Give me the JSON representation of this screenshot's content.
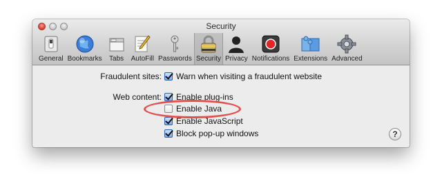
{
  "window": {
    "title": "Security"
  },
  "toolbar": {
    "items": [
      {
        "label": "General",
        "icon": "switch-icon"
      },
      {
        "label": "Bookmarks",
        "icon": "globe-icon"
      },
      {
        "label": "Tabs",
        "icon": "tabs-icon"
      },
      {
        "label": "AutoFill",
        "icon": "pencil-icon"
      },
      {
        "label": "Passwords",
        "icon": "key-icon"
      },
      {
        "label": "Security",
        "icon": "lock-icon",
        "selected": true
      },
      {
        "label": "Privacy",
        "icon": "silhouette-icon"
      },
      {
        "label": "Notifications",
        "icon": "notification-icon"
      },
      {
        "label": "Extensions",
        "icon": "puzzle-icon"
      },
      {
        "label": "Advanced",
        "icon": "gear-icon"
      }
    ]
  },
  "security": {
    "fraudulent_label": "Fraudulent sites:",
    "fraudulent_option": {
      "label": "Warn when visiting a fraudulent website",
      "checked": true
    },
    "web_content_label": "Web content:",
    "web_content_options": [
      {
        "label": "Enable plug-ins",
        "checked": true
      },
      {
        "label": "Enable Java",
        "checked": false
      },
      {
        "label": "Enable JavaScript",
        "checked": true
      },
      {
        "label": "Block pop-up windows",
        "checked": true
      }
    ]
  },
  "help": {
    "label": "?"
  },
  "colors": {
    "highlight_ellipse": "#e35050",
    "window_bg": "#ececec"
  }
}
